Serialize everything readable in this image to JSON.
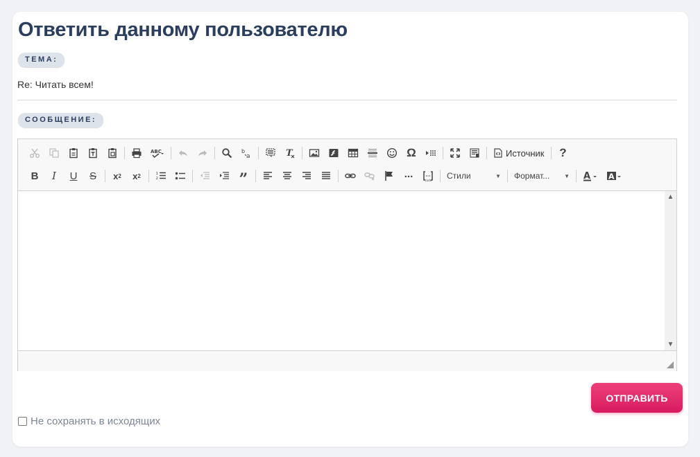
{
  "title": "Ответить данному пользователю",
  "topic_label": "ТЕМА:",
  "subject_value": "Re: Читать всем!",
  "message_label": "СООБЩЕНИЕ:",
  "toolbar": {
    "source_label": "Источник",
    "help_label": "?",
    "styles_label": "Стили",
    "format_label": "Формат..."
  },
  "submit_label": "ОТПРАВИТЬ",
  "checkbox_label": "Не сохранять в исходящих",
  "colors": {
    "title": "#2c3e5d",
    "accent": "#e91e63",
    "badge_bg": "#dde3ea"
  }
}
